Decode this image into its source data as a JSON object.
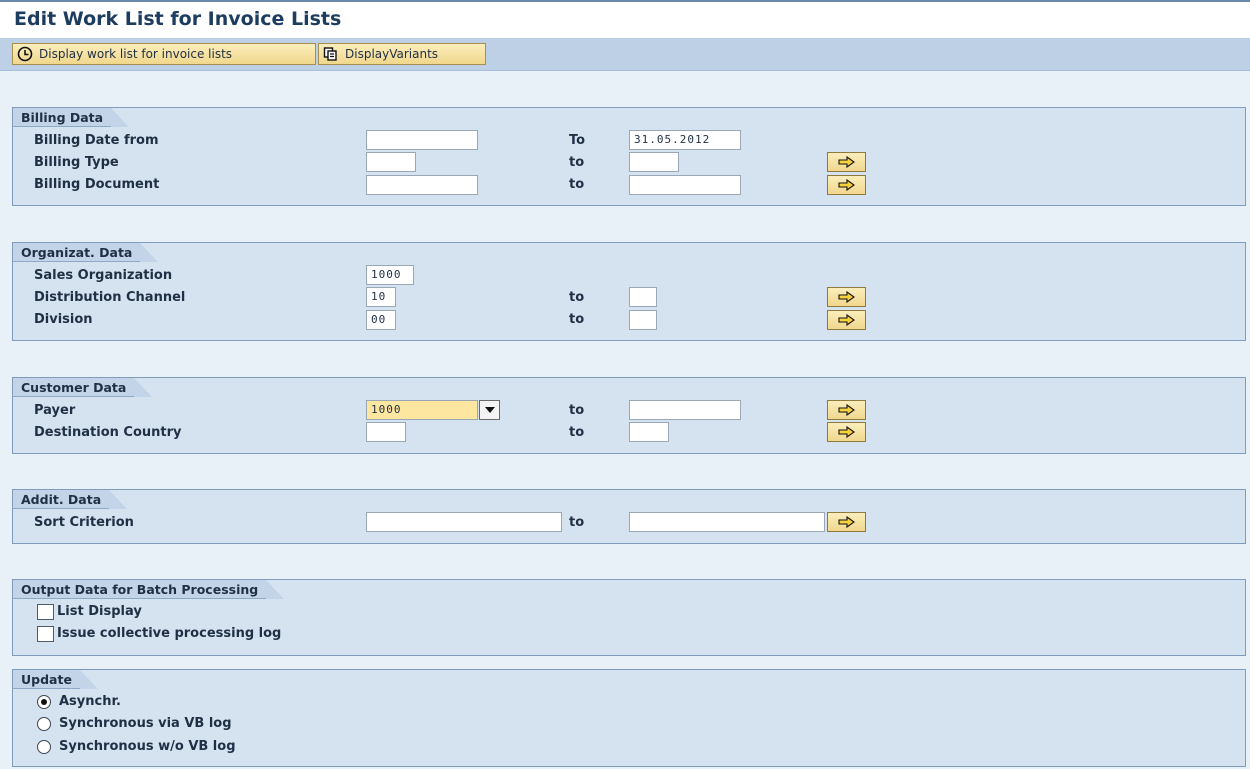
{
  "page": {
    "title": "Edit Work List for Invoice Lists"
  },
  "toolbar": {
    "display_worklist_label": "Display work list for invoice lists",
    "display_variants_label": "DisplayVariants"
  },
  "billing": {
    "title": "Billing Data",
    "date_label": "Billing Date from",
    "date_from": "",
    "date_to_label": "To",
    "date_to": "31.05.2012",
    "type_label": "Billing Type",
    "type_to_label": "to",
    "doc_label": "Billing Document",
    "doc_to_label": "to"
  },
  "org": {
    "title": "Organizat. Data",
    "sales_org_label": "Sales Organization",
    "sales_org": "1000",
    "channel_label": "Distribution Channel",
    "channel": "10",
    "channel_to_label": "to",
    "division_label": "Division",
    "division": "00",
    "division_to_label": "to"
  },
  "customer": {
    "title": "Customer Data",
    "payer_label": "Payer",
    "payer": "1000",
    "payer_to_label": "to",
    "country_label": "Destination Country",
    "country_to_label": "to"
  },
  "addit": {
    "title": "Addit. Data",
    "sort_label": "Sort Criterion",
    "sort_to_label": "to"
  },
  "output": {
    "title": "Output Data for Batch Processing",
    "list_display_label": "List Display",
    "log_label": "Issue collective processing log"
  },
  "update": {
    "title": "Update",
    "asynch_label": "Asynchr.",
    "sync_vb_label": "Synchronous via VB log",
    "sync_novb_label": "Synchronous w/o VB log",
    "selected": "Asynchr."
  },
  "colors": {
    "background": "#e9f1f8",
    "toolbar": "#bdd0e6",
    "group": "#d5e3f0",
    "button": "#f0d78c",
    "highlight_field": "#fde7a0"
  },
  "icons": {
    "clock": "clock-icon",
    "variants": "variants-icon",
    "multiple_selection": "arrow-right-icon",
    "dropdown": "chevron-down-icon"
  }
}
